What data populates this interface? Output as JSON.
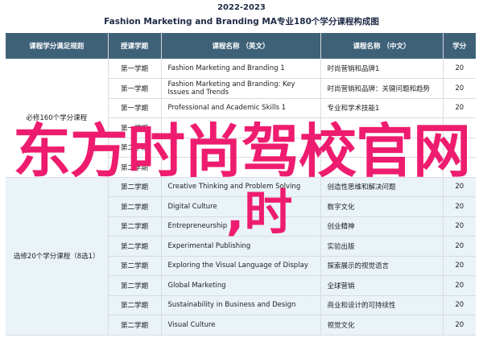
{
  "header": {
    "year": "2022-2023",
    "title": "Fashion Marketing and Branding MA专业180个学分课程构成图"
  },
  "table": {
    "columns": [
      "课程学分满足规则",
      "授课学期",
      "课程名称 （英文）",
      "课程名称 （中文）",
      "学分"
    ],
    "groups": [
      {
        "label": "必修160个学分课程",
        "type": "compulsory",
        "rows": [
          {
            "semester": "第一学期",
            "en": "Fashion Marketing and Branding 1",
            "cn": "时尚营销和品牌1",
            "credits": "20"
          },
          {
            "semester": "第一学期",
            "en": "Fashion Marketing and Branding: Key Issues and Trends",
            "cn": "时尚营销和品牌：关键问题和趋势",
            "credits": "20"
          },
          {
            "semester": "第一学期",
            "en": "Professional and Academic Skills 1",
            "cn": "专业和学术技能1",
            "credits": "20"
          },
          {
            "semester": "第一学期",
            "en": "",
            "cn": "",
            "credits": ""
          },
          {
            "semester": "第二学期",
            "en": "",
            "cn": "",
            "credits": ""
          },
          {
            "semester": "第二学期",
            "en": "",
            "cn": "",
            "credits": ""
          }
        ]
      },
      {
        "label": "选修20个学分课程（8选1）",
        "type": "elective",
        "rows": [
          {
            "semester": "第二学期",
            "en": "Creative Thinking and Problem Solving",
            "cn": "创造性思维和解决问题",
            "credits": "20"
          },
          {
            "semester": "第二学期",
            "en": "Digital Culture",
            "cn": "数字文化",
            "credits": "20"
          },
          {
            "semester": "第二学期",
            "en": "Entrepreneurship",
            "cn": "创业精神",
            "credits": "20"
          },
          {
            "semester": "第二学期",
            "en": "Experimental Publishing",
            "cn": "实验出版",
            "credits": "20"
          },
          {
            "semester": "第二学期",
            "en": "Exploring the Visual Language of Display",
            "cn": "探索展示的视觉语言",
            "credits": "20"
          },
          {
            "semester": "第二学期",
            "en": "Global Marketing",
            "cn": "全球营销",
            "credits": "20"
          },
          {
            "semester": "第二学期",
            "en": "Sustainability in Business and Design",
            "cn": "商业和设计的可持续性",
            "credits": "20"
          },
          {
            "semester": "第二学期",
            "en": "Visual Culture",
            "cn": "视觉文化",
            "credits": "20"
          }
        ]
      }
    ]
  },
  "watermark": {
    "line1": "东方时尚驾校官网",
    "line2": ",时"
  },
  "colors": {
    "header_bg": "#3e6178",
    "elective_bg": "#eaf3f8",
    "watermark": "#ee1c6f",
    "title": "#1e2a44"
  }
}
